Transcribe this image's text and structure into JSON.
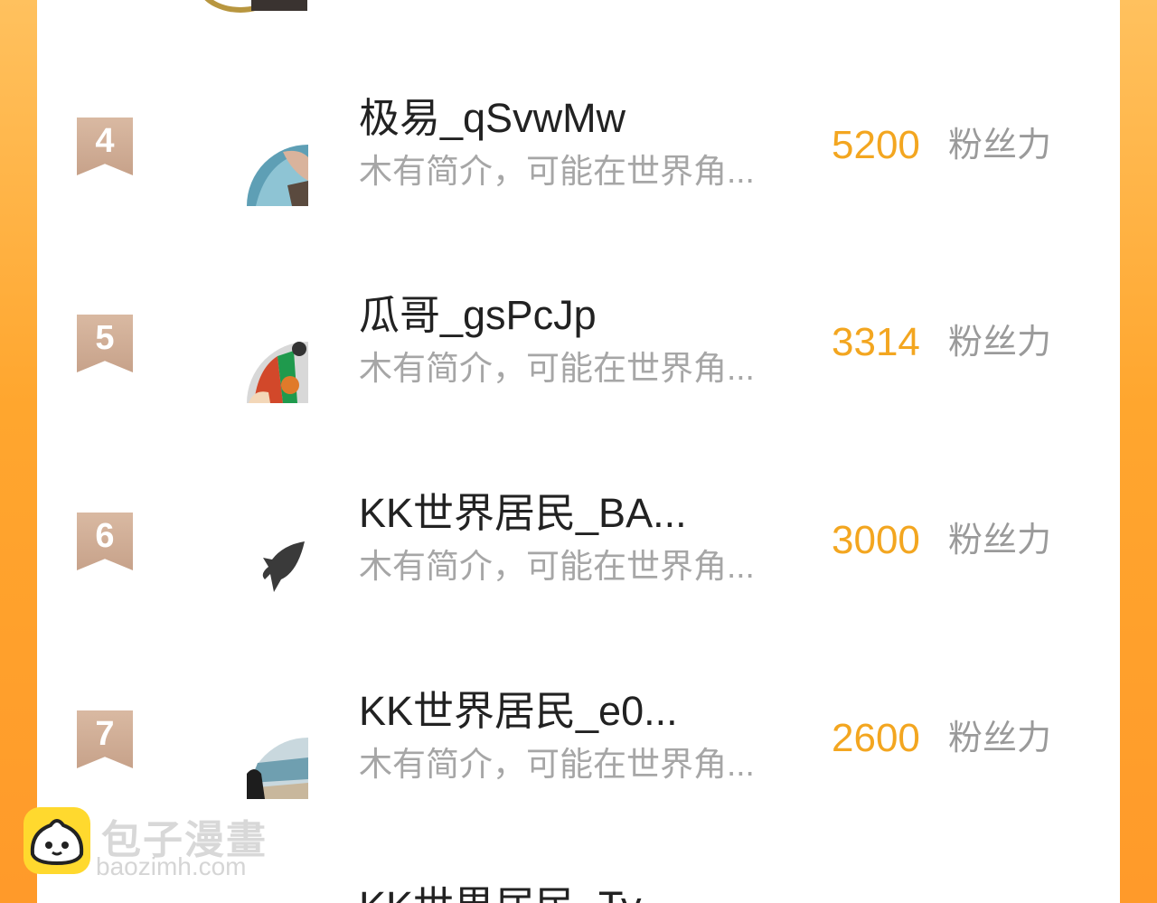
{
  "ranking": {
    "rows": [
      {
        "rank": "4",
        "name": "极易_qSvwMw",
        "intro": "木有简介，可能在世界角...",
        "score": "5200",
        "unit": "粉丝力"
      },
      {
        "rank": "5",
        "name": "瓜哥_gsPcJp",
        "intro": "木有简介，可能在世界角...",
        "score": "3314",
        "unit": "粉丝力"
      },
      {
        "rank": "6",
        "name": "KK世界居民_BA...",
        "intro": "木有简介，可能在世界角...",
        "score": "3000",
        "unit": "粉丝力"
      },
      {
        "rank": "7",
        "name": "KK世界居民_e0...",
        "intro": "木有简介，可能在世界角...",
        "score": "2600",
        "unit": "粉丝力"
      }
    ],
    "partial_row_name": "KK世界居民_Ty"
  },
  "watermark": {
    "title": "包子漫畫",
    "url": "baozimh.com"
  },
  "colors": {
    "score": "#f3a620",
    "rank_badge": "#c9a58d",
    "frame": "#ffa62e"
  },
  "icons": {
    "avatar_row_6": "shark-icon",
    "watermark_logo": "bun-mascot-icon"
  }
}
